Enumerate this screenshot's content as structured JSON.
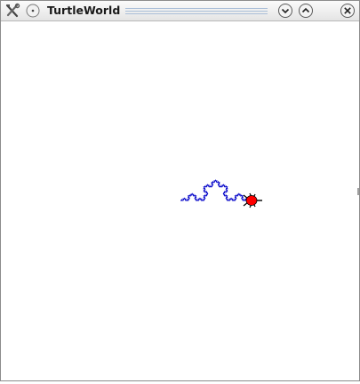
{
  "window": {
    "title": "TurtleWorld"
  },
  "titlebar": {
    "buttons": [
      {
        "name": "app-menu",
        "icon": "tools-icon"
      },
      {
        "name": "sticky",
        "icon": "circle-dot-icon"
      },
      {
        "name": "minimize",
        "icon": "chevron-down-icon"
      },
      {
        "name": "maximize",
        "icon": "chevron-up-icon"
      },
      {
        "name": "close",
        "icon": "close-icon"
      }
    ]
  },
  "canvas": {
    "background": "#ffffff",
    "path_color": "#0000c8",
    "turtle_color": "#ff0000"
  }
}
